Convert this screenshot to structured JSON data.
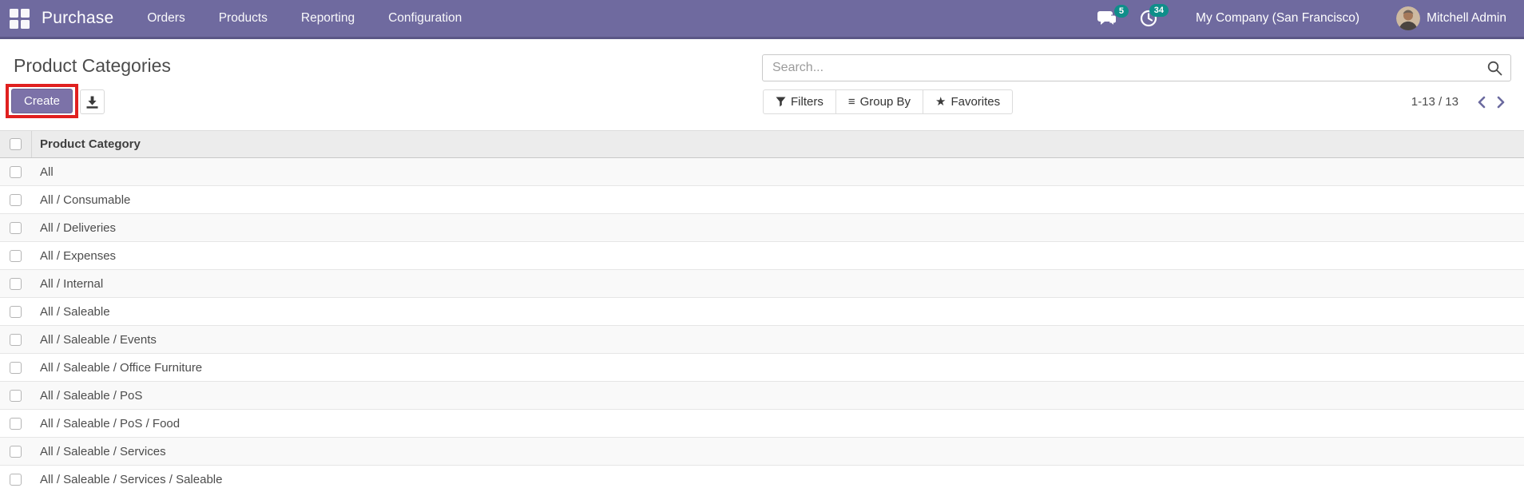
{
  "navbar": {
    "brand": "Purchase",
    "menu_items": [
      "Orders",
      "Products",
      "Reporting",
      "Configuration"
    ],
    "messages_badge": "5",
    "activities_badge": "34",
    "company": "My Company (San Francisco)",
    "user": "Mitchell Admin"
  },
  "control_panel": {
    "title": "Product Categories",
    "create_label": "Create",
    "search_placeholder": "Search...",
    "filters_label": "Filters",
    "group_by_label": "Group By",
    "favorites_label": "Favorites",
    "pager_range": "1-13 / 13"
  },
  "icons": {
    "apps": "grid-squares",
    "messages": "chat-bubbles",
    "activities": "clock",
    "export": "download",
    "search": "magnifier",
    "filters": "funnel",
    "group_by_glyph": "≡",
    "favorites_glyph": "★",
    "prev": "chevron-left",
    "next": "chevron-right"
  },
  "table": {
    "header": "Product Category",
    "rows": [
      "All",
      "All / Consumable",
      "All / Deliveries",
      "All / Expenses",
      "All / Internal",
      "All / Saleable",
      "All / Saleable / Events",
      "All / Saleable / Office Furniture",
      "All / Saleable / PoS",
      "All / Saleable / PoS / Food",
      "All / Saleable / Services",
      "All / Saleable / Services / Saleable"
    ]
  },
  "colors": {
    "navbar_bg": "#6f6a9f",
    "navbar_border": "#5b5786",
    "primary_button_bg": "#7c72a8",
    "badge_bg": "#0f8e8a",
    "annotation_red": "#e0201f",
    "pager_chevron": "#6b6a9f"
  }
}
